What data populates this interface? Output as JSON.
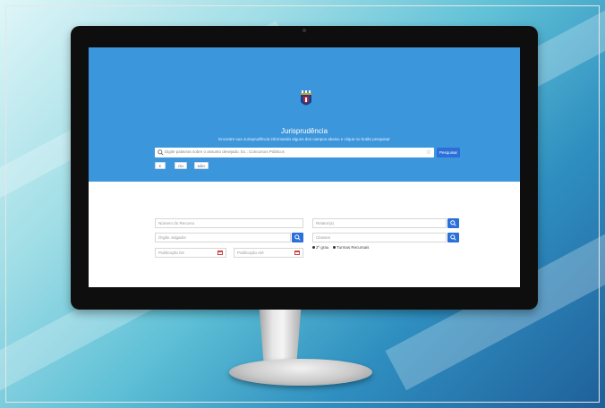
{
  "hero": {
    "title": "Jurisprudência",
    "subtitle": "Encontre sua Jurisprudência informando alguns dos campos abaixo e clique no botão pesquisar"
  },
  "search": {
    "placeholder": "Digite palavras sobre o assunto desejado. Ex.: Concursos Públicos",
    "button_label": "Pesquisar"
  },
  "operators": [
    "E",
    "OU",
    "NÃO"
  ],
  "form": {
    "numero_recurso": "Número do Recurso",
    "orgao_julgador": "Órgão Julgador",
    "publicacao_de": "Publicação De",
    "publicacao_ate": "Publicação Até",
    "relator": "Relator(a)",
    "classes": "Classes",
    "filters": [
      "2º grau",
      "Turmas Recursais"
    ]
  },
  "colors": {
    "hero_bg": "#3c96dc",
    "button_blue": "#2b6fd8"
  }
}
